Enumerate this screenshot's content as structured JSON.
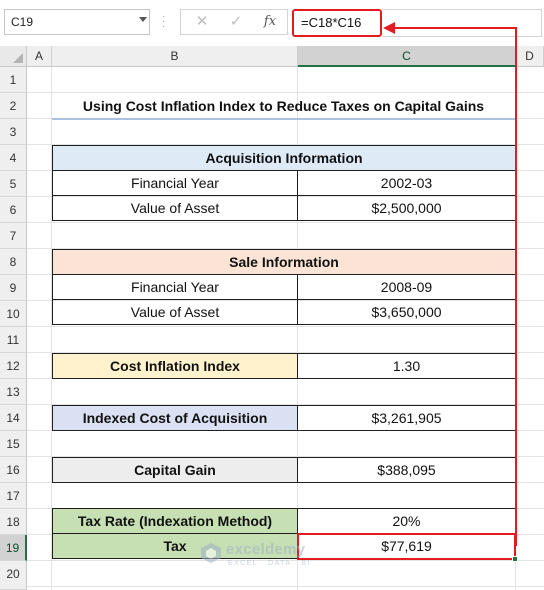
{
  "formula_bar": {
    "name_box": "C19",
    "cancel_glyph": "✕",
    "enter_glyph": "✓",
    "fx_label": "fx",
    "formula": "=C18*C16"
  },
  "columns": [
    "A",
    "B",
    "C",
    "D"
  ],
  "rows": [
    "1",
    "2",
    "3",
    "4",
    "5",
    "6",
    "7",
    "8",
    "9",
    "10",
    "11",
    "12",
    "13",
    "14",
    "15",
    "16",
    "17",
    "18",
    "19",
    "20"
  ],
  "sheet": {
    "title": "Using Cost Inflation Index to Reduce Taxes on Capital Gains",
    "acquisition": {
      "header": "Acquisition Information",
      "year_label": "Financial Year",
      "year_value": "2002-03",
      "value_label": "Value of Asset",
      "value_value": "$2,500,000"
    },
    "sale": {
      "header": "Sale Information",
      "year_label": "Financial Year",
      "year_value": "2008-09",
      "value_label": "Value of Asset",
      "value_value": "$3,650,000"
    },
    "cii": {
      "label": "Cost Inflation Index",
      "value": "1.30"
    },
    "indexed_cost": {
      "label": "Indexed Cost of Acquisition",
      "value": "$3,261,905"
    },
    "capital_gain": {
      "label": "Capital Gain",
      "value": "$388,095"
    },
    "tax_rate": {
      "label": "Tax Rate (Indexation Method)",
      "value": "20%"
    },
    "tax": {
      "label": "Tax",
      "value": "$77,619"
    }
  },
  "watermark": {
    "name": "exceldemy",
    "tagline": "EXCEL · DATA · BI"
  },
  "colors": {
    "acquisition_fill": "#deeaf6",
    "sale_fill": "#fbe4d5",
    "cii_fill": "#fff2cc",
    "indexed_fill": "#d9e1f2",
    "capital_fill": "#ededed",
    "tax_fill": "#c6e0b4",
    "annotation_red": "#e31b23",
    "selection_green": "#217346"
  }
}
